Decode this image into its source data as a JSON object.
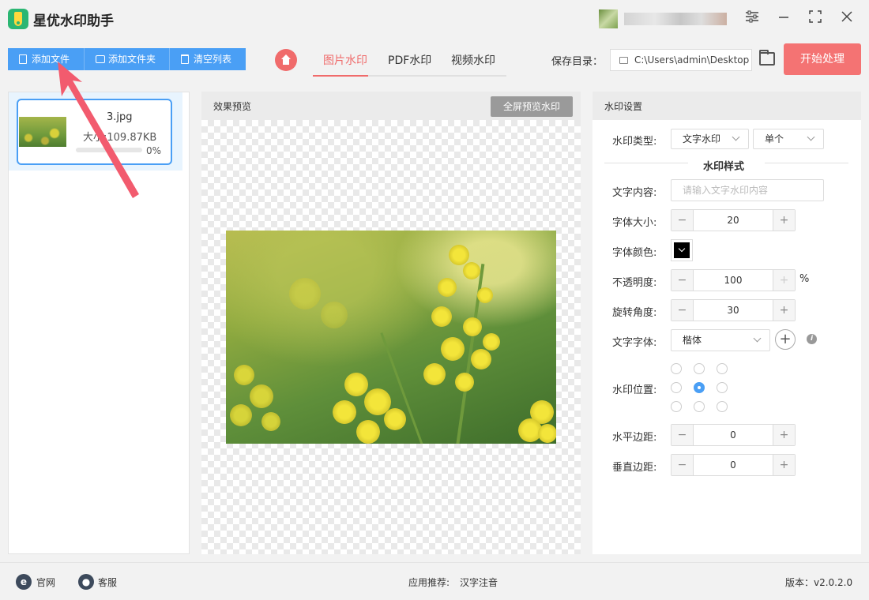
{
  "app": {
    "title": "星优水印助手"
  },
  "window": {
    "settings_icon": "sliders-icon",
    "minimize_icon": "minimize-icon",
    "maximize_icon": "maximize-icon",
    "close_icon": "close-icon"
  },
  "toolbar": {
    "add_file": "添加文件",
    "add_folder": "添加文件夹",
    "clear_list": "清空列表"
  },
  "tabs": [
    {
      "label": "图片水印",
      "active": true
    },
    {
      "label": "PDF水印",
      "active": false
    },
    {
      "label": "视频水印",
      "active": false
    }
  ],
  "save": {
    "label": "保存目录：",
    "path": "C:\\Users\\admin\\Desktop",
    "start_button": "开始处理"
  },
  "files": [
    {
      "name": "3.jpg",
      "size": "大小:109.87KB",
      "progress_text": "0%",
      "progress": 0
    }
  ],
  "preview": {
    "title": "效果预览",
    "fullscreen_button": "全屏预览水印"
  },
  "settings": {
    "title": "水印设置",
    "type_label": "水印类型:",
    "type_value": "文字水印",
    "mode_value": "单个",
    "style_section": "水印样式",
    "text_label": "文字内容:",
    "text_placeholder": "请输入文字水印内容",
    "font_size_label": "字体大小:",
    "font_size": "20",
    "font_color_label": "字体颜色:",
    "font_color": "#000000",
    "opacity_label": "不透明度:",
    "opacity": "100",
    "opacity_unit": "%",
    "rotation_label": "旋转角度:",
    "rotation": "30",
    "font_family_label": "文字字体:",
    "font_family": "楷体",
    "position_label": "水印位置:",
    "position_selected": "middle-left",
    "h_margin_label": "水平边距:",
    "h_margin": "0",
    "v_margin_label": "垂直边距:",
    "v_margin": "0",
    "minus": "−",
    "plus": "+"
  },
  "footer": {
    "website": "官网",
    "service": "客服",
    "recommend_label": "应用推荐:",
    "recommend_app": "汉字注音",
    "version": "版本：v2.0.2.0"
  },
  "colors": {
    "accent": "#4a9ff5",
    "brand_red": "#f47373"
  }
}
